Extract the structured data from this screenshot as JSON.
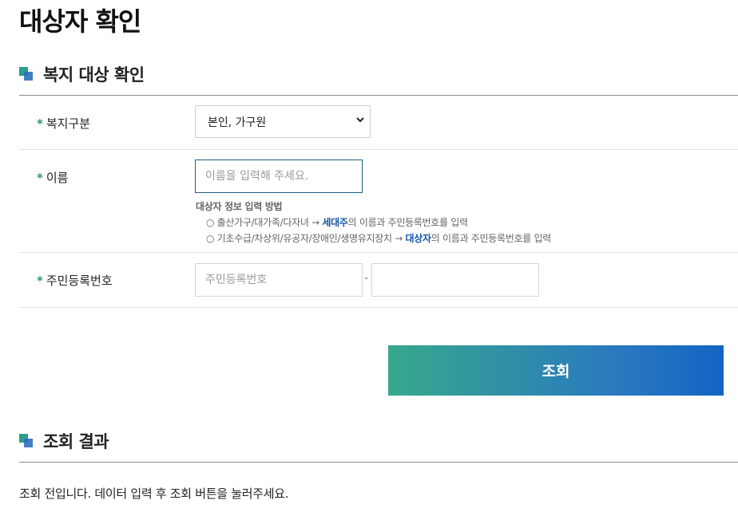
{
  "page": {
    "title": "대상자 확인"
  },
  "welfare_section": {
    "title": "복지 대상 확인"
  },
  "form": {
    "required_mark": "*",
    "welfare_type": {
      "label": "복지구분",
      "selected": "본인, 가구원"
    },
    "name": {
      "label": "이름",
      "placeholder": "이름을 입력해 주세요.",
      "value": ""
    },
    "guide": {
      "title": "대상자 정보 입력 방법",
      "line1_prefix": "○ 출산가구/대가족/다자녀 → ",
      "line1_highlight": "세대주",
      "line1_suffix": "의 이름과 주민등록번호를 입력",
      "line2_prefix": "○ 기초수급/차상위/유공자/장애인/생명유지장치 → ",
      "line2_highlight": "대상자",
      "line2_suffix": "의 이름과 주민등록번호를 입력"
    },
    "rrn": {
      "label": "주민등록번호",
      "placeholder_front": "주민등록번호",
      "separator": "-",
      "value_front": "",
      "value_back": ""
    }
  },
  "search_button": {
    "label": "조회"
  },
  "result_section": {
    "title": "조회 결과",
    "message": "조회 전입니다. 데이터 입력 후 조회 버튼을 눌러주세요."
  },
  "colors": {
    "accent_green": "#2e9b6d",
    "highlight_blue": "#1a56a8",
    "button_gradient_start": "#38a88d",
    "button_gradient_end": "#1464c4"
  },
  "icons": {
    "section_bullet": "two-square-bullet-icon",
    "select_arrow": "chevron-down-icon"
  }
}
